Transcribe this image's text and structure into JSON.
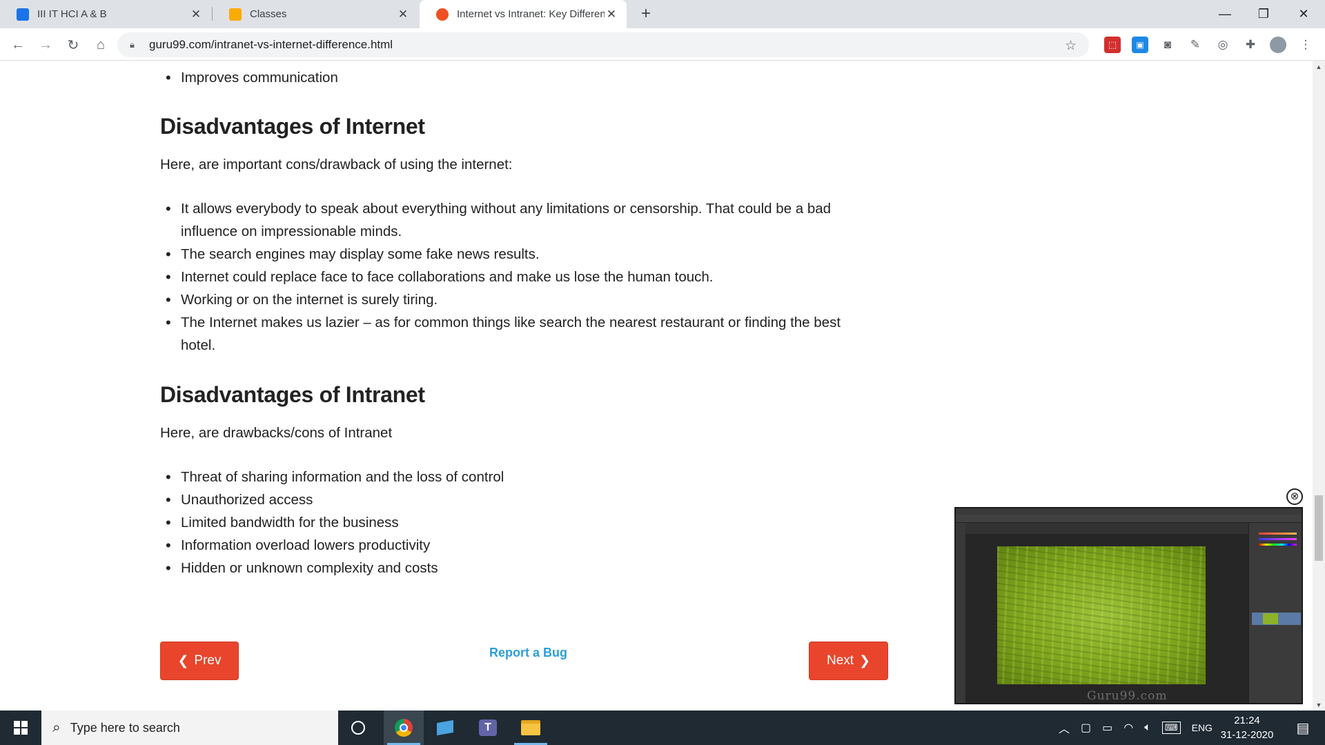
{
  "browser": {
    "tabs": [
      {
        "title": "III IT HCI A & B",
        "active": false,
        "favicon_color": "#1a73e8"
      },
      {
        "title": "Classes",
        "active": false,
        "favicon_color": "#f9ab00"
      },
      {
        "title": "Internet vs Intranet: Key Differenc",
        "active": true,
        "favicon_color": "#f25022"
      }
    ],
    "new_tab_label": "+",
    "url": "guru99.com/intranet-vs-internet-difference.html"
  },
  "article": {
    "intro_bullet": "Improves communication",
    "internet": {
      "heading": "Disadvantages of Internet",
      "lead": "Here, are important cons/drawback of using the internet:",
      "items": [
        "It allows everybody to speak about everything without any limitations or censorship. That could be a bad influence on impressionable minds.",
        "The search engines may display some fake news results.",
        "Internet could replace face to face collaborations and make us lose the human touch.",
        "Working or on the internet is surely tiring.",
        "The Internet makes us lazier – as for common things like search the nearest restaurant or finding the best hotel."
      ]
    },
    "intranet": {
      "heading": "Disadvantages of Intranet",
      "lead": "Here, are drawbacks/cons of Intranet",
      "items": [
        "Threat of sharing information and the loss of control",
        "Unauthorized access",
        "Limited bandwidth for the business",
        "Information overload lowers productivity",
        "Hidden or unknown complexity and costs"
      ]
    },
    "nav": {
      "prev": "Prev",
      "report_bug": "Report a Bug",
      "next": "Next"
    }
  },
  "video": {
    "close_glyph": "⊗",
    "watermark": "Guru99.com"
  },
  "taskbar": {
    "search_placeholder": "Type here to search",
    "language": "ENG",
    "time": "21:24",
    "date": "31-12-2020"
  },
  "colors": {
    "accent_button": "#e8452c",
    "link": "#2a9fd8",
    "taskbar": "#1f2a33"
  }
}
